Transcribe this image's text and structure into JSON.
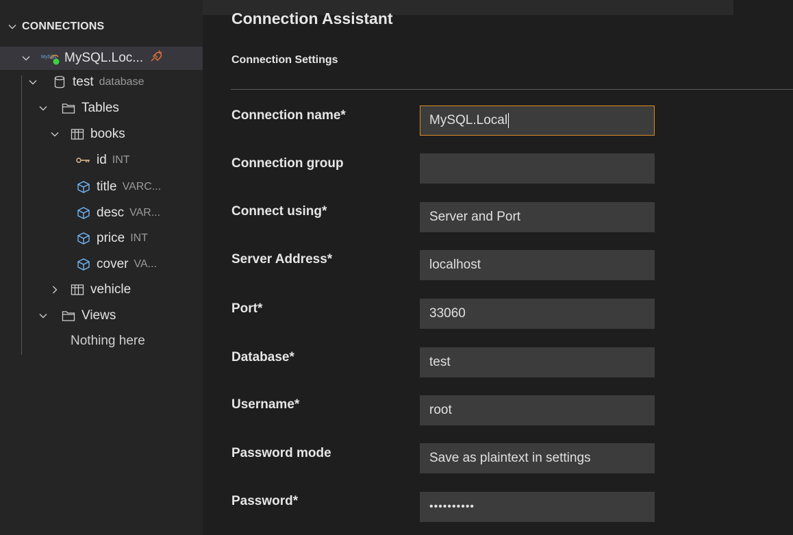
{
  "sidebar": {
    "header": "CONNECTIONS",
    "tree": {
      "connection": {
        "label": "MySQL.Loc...",
        "logo_text": "MySQL"
      },
      "database": {
        "label": "test",
        "desc": "database"
      },
      "tables_folder": {
        "label": "Tables"
      },
      "books": {
        "label": "books"
      },
      "columns": [
        {
          "label": "id",
          "desc": "INT",
          "icon": "key-icon"
        },
        {
          "label": "title",
          "desc": "VARC...",
          "icon": "column-icon"
        },
        {
          "label": "desc",
          "desc": "VAR...",
          "icon": "column-icon"
        },
        {
          "label": "price",
          "desc": "INT",
          "icon": "column-icon"
        },
        {
          "label": "cover",
          "desc": "VA...",
          "icon": "column-icon"
        }
      ],
      "vehicle": {
        "label": "vehicle"
      },
      "views_folder": {
        "label": "Views"
      },
      "views_empty": "Nothing here"
    }
  },
  "main": {
    "title": "Connection Assistant",
    "section": "Connection Settings",
    "fields": {
      "connection_name": {
        "label": "Connection name*",
        "value": "MySQL.Local"
      },
      "connection_group": {
        "label": "Connection group",
        "value": ""
      },
      "connect_using": {
        "label": "Connect using*",
        "value": "Server and Port"
      },
      "server_address": {
        "label": "Server Address*",
        "value": "localhost"
      },
      "port": {
        "label": "Port*",
        "value": "33060"
      },
      "database": {
        "label": "Database*",
        "value": "test"
      },
      "username": {
        "label": "Username*",
        "value": "root"
      },
      "password_mode": {
        "label": "Password mode",
        "value": "Save as plaintext in settings"
      },
      "password": {
        "label": "Password*",
        "value": "••••••••••"
      }
    }
  },
  "colors": {
    "focus_border": "#d98c1f",
    "key_icon": "#e2c08d",
    "column_icon": "#75beff",
    "connected_dot": "#3fd13f",
    "disconnect_icon": "#f0703c"
  }
}
